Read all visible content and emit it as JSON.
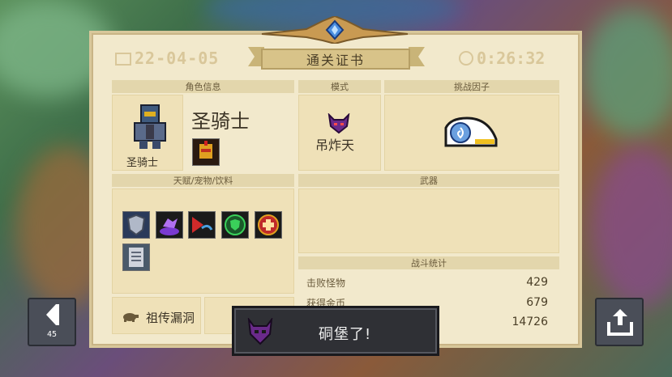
{
  "certificate": {
    "date": "22-04-05",
    "title": "通关证书",
    "time": "0:26:32"
  },
  "sections": {
    "character_info": "角色信息",
    "mode": "模式",
    "challenge_factor": "挑战因子",
    "talents_pets_drinks": "天赋/宠物/饮料",
    "weapons": "武器",
    "battle_stats": "战斗统计"
  },
  "character": {
    "name": "圣骑士",
    "label": "圣骑士"
  },
  "mode": {
    "label": "吊炸天"
  },
  "relic": {
    "label": "祖传漏洞"
  },
  "stats": [
    {
      "label": "击败怪物",
      "value": "429"
    },
    {
      "label": "获得金币",
      "value": "679"
    },
    {
      "label": "",
      "value": "14726"
    }
  ],
  "left_button": {
    "count": "45"
  },
  "toast": {
    "message": "硐堡了!"
  },
  "colors": {
    "card_bg": "#f2e9cc",
    "header_bg": "#e3d6ac",
    "toast_bg": "#2f3035",
    "accent_gold": "#d9c79a"
  },
  "icons": {
    "talents": [
      "shield-icon",
      "purple-hand-icon",
      "red-dash-icon",
      "green-shield-icon",
      "red-cross-icon",
      "clipboard-icon"
    ],
    "challenge": "blue-cap-icon",
    "relic": "turtle-icon",
    "share": "share-icon",
    "back": "back-arrow-icon"
  }
}
